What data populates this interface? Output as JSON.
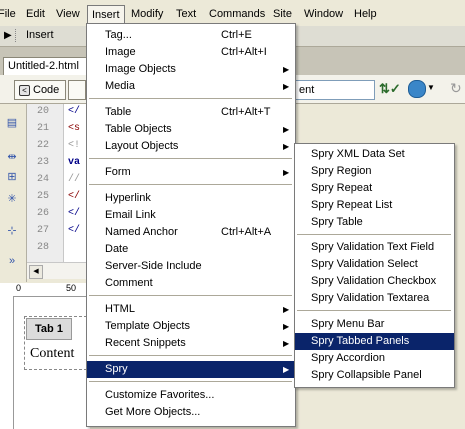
{
  "menubar": {
    "items": [
      "File",
      "Edit",
      "View",
      "Insert",
      "Modify",
      "Text",
      "Commands",
      "Site",
      "Window",
      "Help"
    ],
    "active": "Insert"
  },
  "insertbar": {
    "label": "Insert"
  },
  "document": {
    "tab": "Untitled-2.html"
  },
  "doctoolbar": {
    "code_label": "Code",
    "title_value": "ent"
  },
  "code": {
    "lines": [
      "20",
      "21",
      "22",
      "23",
      "24",
      "25",
      "26",
      "27",
      "28"
    ],
    "snippets": [
      "</",
      "<s",
      "<!",
      "va",
      "//",
      "</",
      "</",
      "</",
      ""
    ]
  },
  "design": {
    "tab1": "Tab 1",
    "content": "Content",
    "ruler_0": "0",
    "ruler_50": "50"
  },
  "insert_menu": {
    "items": [
      {
        "label": "Tag...",
        "shortcut": "Ctrl+E"
      },
      {
        "label": "Image",
        "shortcut": "Ctrl+Alt+I"
      },
      {
        "label": "Image Objects",
        "submenu": true
      },
      {
        "label": "Media",
        "submenu": true
      },
      {
        "label": "Table",
        "shortcut": "Ctrl+Alt+T"
      },
      {
        "label": "Table Objects",
        "submenu": true
      },
      {
        "label": "Layout Objects",
        "submenu": true
      },
      {
        "label": "Form",
        "submenu": true
      },
      {
        "label": "Hyperlink"
      },
      {
        "label": "Email Link"
      },
      {
        "label": "Named Anchor",
        "shortcut": "Ctrl+Alt+A"
      },
      {
        "label": "Date"
      },
      {
        "label": "Server-Side Include"
      },
      {
        "label": "Comment"
      },
      {
        "label": "HTML",
        "submenu": true
      },
      {
        "label": "Template Objects",
        "submenu": true
      },
      {
        "label": "Recent Snippets",
        "submenu": true
      },
      {
        "label": "Spry",
        "submenu": true,
        "highlighted": true
      },
      {
        "label": "Customize Favorites..."
      },
      {
        "label": "Get More Objects..."
      }
    ]
  },
  "spry_menu": {
    "items": [
      "Spry XML Data Set",
      "Spry Region",
      "Spry Repeat",
      "Spry Repeat List",
      "Spry Table",
      "Spry Validation Text Field",
      "Spry Validation Select",
      "Spry Validation Checkbox",
      "Spry Validation Textarea",
      "Spry Menu Bar",
      "Spry Tabbed Panels",
      "Spry Accordion",
      "Spry Collapsible Panel"
    ],
    "highlighted": "Spry Tabbed Panels"
  },
  "colors": {
    "highlight": "#0a246a",
    "menu_bg": "#ffffff",
    "chrome": "#ece9d8"
  },
  "icons": [
    "submenu-arrow-icon",
    "code-view-icon",
    "split-view-icon",
    "validate-icon",
    "browser-preview-icon",
    "refresh-icon"
  ]
}
